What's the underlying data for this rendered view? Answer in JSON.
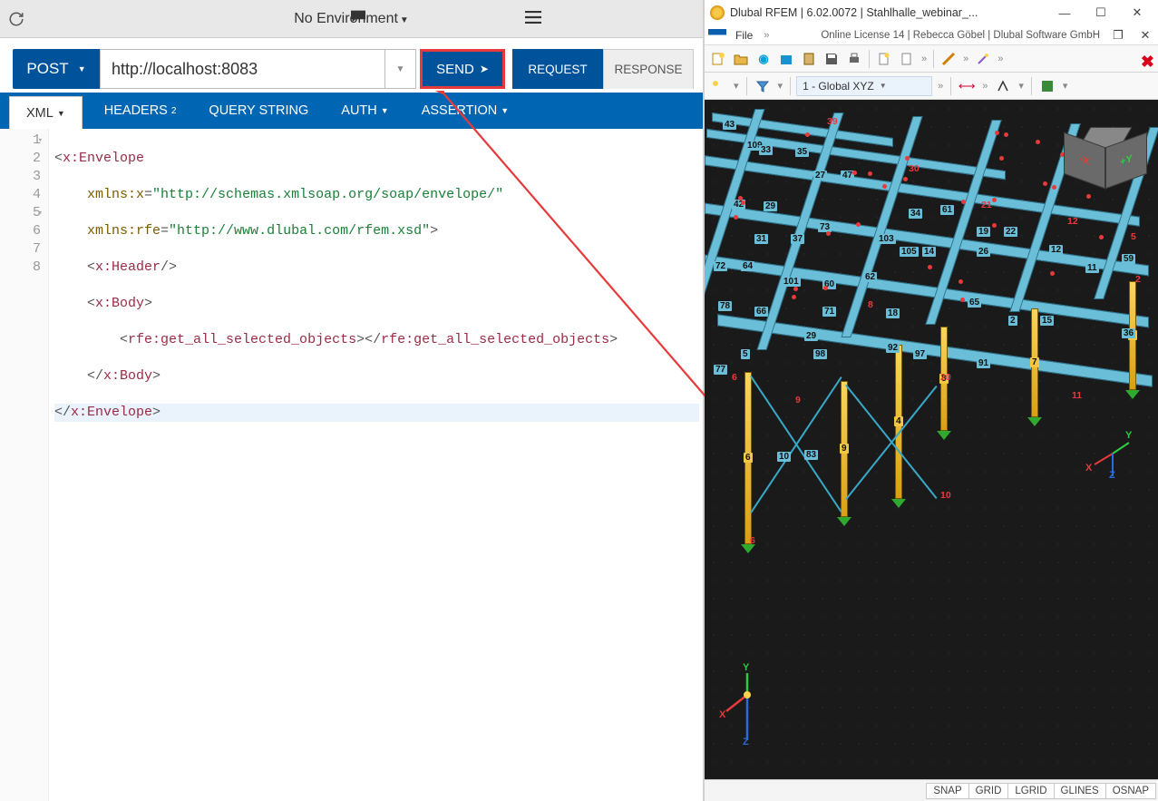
{
  "left": {
    "env": "No Environment",
    "method": "POST",
    "url": "http://localhost:8083",
    "send": "SEND",
    "rrtabs": {
      "request": "REQUEST",
      "response": "RESPONSE"
    },
    "tabs": {
      "xml": "XML",
      "headers": "HEADERS",
      "headers_badge": "2",
      "query": "QUERY STRING",
      "auth": "AUTH",
      "assertion": "ASSERTION"
    },
    "code": {
      "l1a": "<",
      "l1b": "x:Envelope",
      "l2a": "xmlns:x",
      "l2b": "=",
      "l2c": "\"http://schemas.xmlsoap.org/soap/envelope/\"",
      "l3a": "xmlns:rfe",
      "l3b": "=",
      "l3c": "\"http://www.dlubal.com/rfem.xsd\"",
      "l3d": ">",
      "l4a": "<",
      "l4b": "x:Header",
      "l4c": "/>",
      "l5a": "<",
      "l5b": "x:Body",
      "l5c": ">",
      "l6a": "<",
      "l6b": "rfe:get_all_selected_objects",
      "l6c": "></",
      "l6d": "rfe:get_all_selected_objects",
      "l6e": ">",
      "l7a": "</",
      "l7b": "x:Body",
      "l7c": ">",
      "l8a": "</",
      "l8b": "x:Envelope",
      "l8c": ">"
    },
    "line_numbers": [
      "1",
      "2",
      "3",
      "4",
      "5",
      "6",
      "7",
      "8"
    ]
  },
  "right": {
    "title": "Dlubal RFEM | 6.02.0072 | Stahlhalle_webinar_...",
    "menu_file": "File",
    "license_info": "Online License 14 | Rebecca Göbel | Dlubal Software GmbH",
    "coord_system": "1 - Global XYZ",
    "cube": {
      "x": "-X",
      "y": "+Y"
    },
    "status": [
      "SNAP",
      "GRID",
      "LGRID",
      "GLINES",
      "OSNAP"
    ],
    "axis_labels": {
      "x": "X",
      "y": "Y",
      "z": "Z"
    },
    "labels_blue": [
      "43",
      "109",
      "33",
      "35",
      "42",
      "29",
      "27",
      "47",
      "31",
      "37",
      "73",
      "34",
      "103",
      "61",
      "19",
      "22",
      "72",
      "64",
      "101",
      "60",
      "62",
      "105",
      "14",
      "26",
      "12",
      "11",
      "59",
      "78",
      "66",
      "71",
      "18",
      "65",
      "2",
      "15",
      "36",
      "29",
      "5",
      "98",
      "97",
      "77",
      "10",
      "83",
      "92",
      "91"
    ],
    "labels_yellow": [
      "6",
      "9",
      "4",
      "8",
      "7",
      "1"
    ],
    "labels_red": [
      "39",
      "30",
      "21",
      "12",
      "5",
      "20",
      "9",
      "2",
      "8",
      "6",
      "6",
      "10",
      "11"
    ]
  }
}
